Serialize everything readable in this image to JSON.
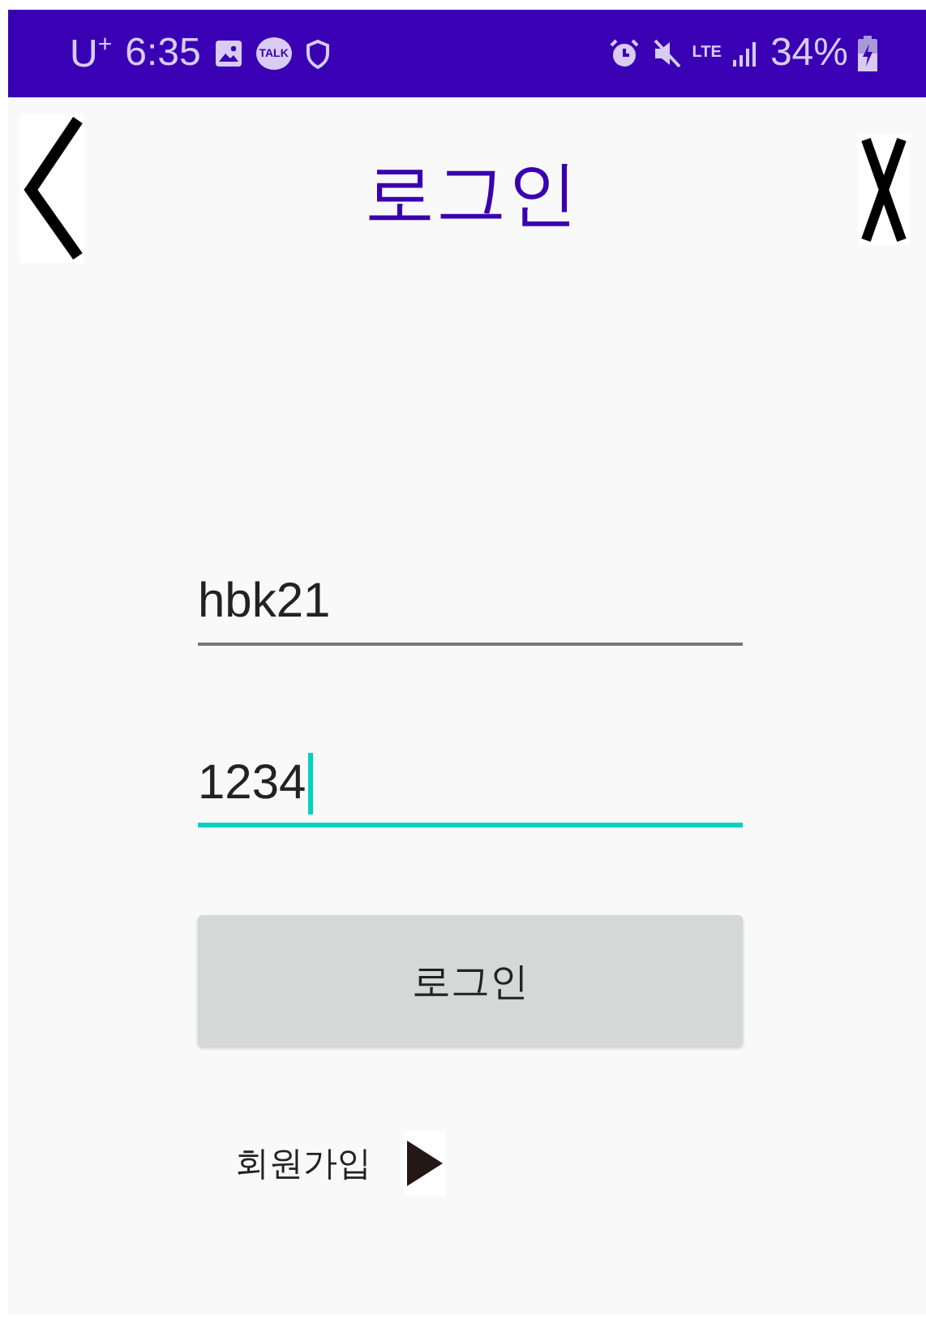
{
  "status_bar": {
    "carrier": "U$^{+}$",
    "time": "6:35",
    "chat_badge": "TALK",
    "network": "LTE",
    "battery": "34%"
  },
  "header": {
    "title": "로그인"
  },
  "fields": [
    {
      "value": "hbk21",
      "focused": false
    },
    {
      "value": "1234",
      "focused": true
    }
  ],
  "login_button": "로그인",
  "signup_link": "회원가입"
}
